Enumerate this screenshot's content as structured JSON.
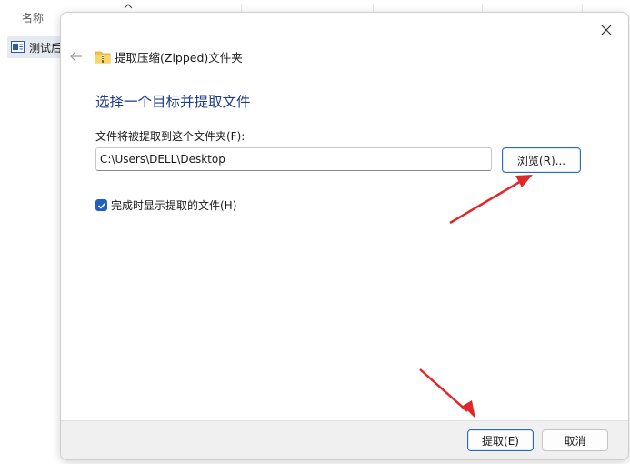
{
  "explorer": {
    "column_header": "名称",
    "file_name": "测试后"
  },
  "dialog": {
    "title": "提取压缩(Zipped)文件夹",
    "heading": "选择一个目标并提取文件",
    "dest_label": "文件将被提取到这个文件夹(F):",
    "path_value": "C:\\Users\\DELL\\Desktop",
    "browse_label": "浏览(R)...",
    "checkbox_label": "完成时显示提取的文件(H)",
    "checkbox_checked": true,
    "extract_label": "提取(E)",
    "cancel_label": "取消"
  },
  "colors": {
    "accent": "#1f5fc4",
    "heading": "#1e3c8c",
    "annotation_arrow": "#e0282b"
  },
  "icons": [
    "chevron-up-icon",
    "file-icon",
    "close-icon",
    "back-arrow-icon",
    "zip-folder-icon",
    "checkmark-icon"
  ]
}
